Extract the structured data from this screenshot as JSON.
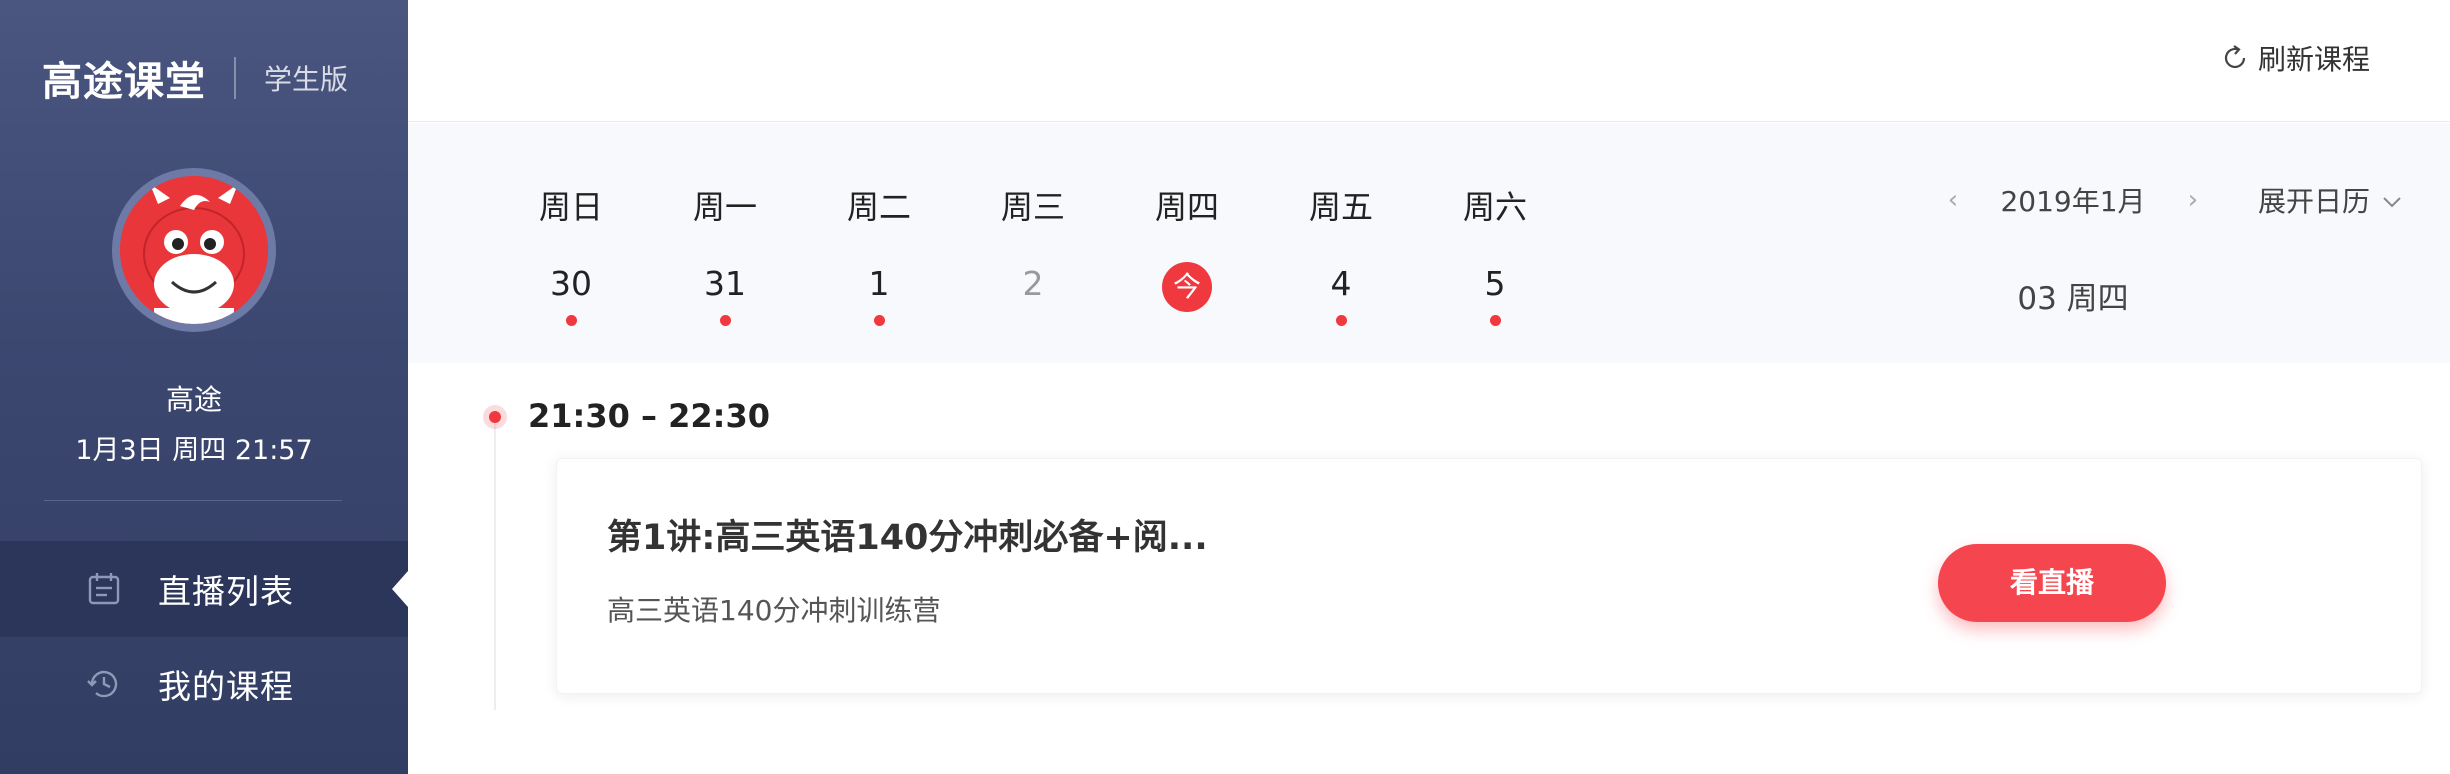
{
  "app": {
    "brand_name": "高途课堂",
    "edition": "学生版"
  },
  "user": {
    "name": "高途",
    "datetime": "1月3日 周四 21:57"
  },
  "nav": {
    "items": [
      {
        "label": "直播列表",
        "icon": "calendar-icon",
        "active": true
      },
      {
        "label": "我的课程",
        "icon": "history-clock-icon",
        "active": false
      }
    ]
  },
  "topbar": {
    "refresh_label": "刷新课程"
  },
  "calendar": {
    "days": [
      {
        "name": "周日",
        "num": "30",
        "has_class": true
      },
      {
        "name": "周一",
        "num": "31",
        "has_class": true
      },
      {
        "name": "周二",
        "num": "1",
        "has_class": true
      },
      {
        "name": "周三",
        "num": "2",
        "has_class": false
      },
      {
        "name": "周四",
        "num": "今",
        "is_today": true
      },
      {
        "name": "周五",
        "num": "4",
        "has_class": true
      },
      {
        "name": "周六",
        "num": "5",
        "has_class": true
      }
    ],
    "month_label": "2019年1月",
    "prev_icon": "chevron-left-icon",
    "next_icon": "chevron-right-icon",
    "expand_label": "展开日历",
    "selected_date": "03 周四"
  },
  "schedule": {
    "time_range": "21:30 – 22:30",
    "lesson": {
      "title": "第1讲:高三英语140分冲刺必备+阅...",
      "course": "高三英语140分冲刺训练营",
      "action_label": "看直播"
    }
  },
  "colors": {
    "sidebar_top": "#4a5680",
    "sidebar_bottom": "#323d63",
    "accent_red": "#f0383f",
    "button_red": "#f5454f"
  }
}
